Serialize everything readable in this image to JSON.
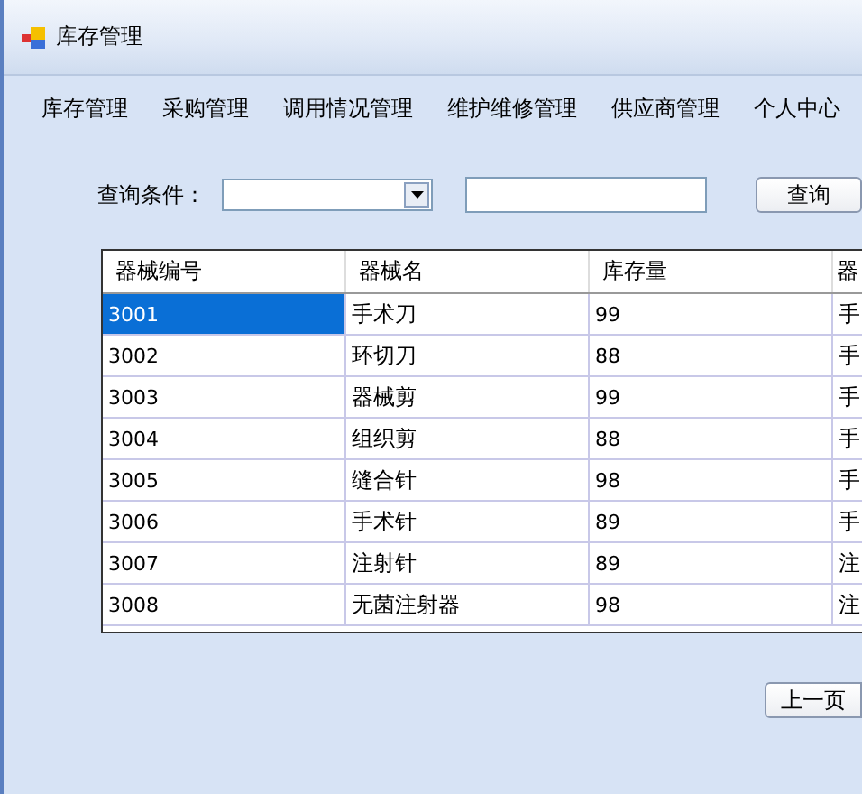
{
  "window": {
    "title": "库存管理"
  },
  "menu": [
    {
      "label": "库存管理"
    },
    {
      "label": "采购管理"
    },
    {
      "label": "调用情况管理"
    },
    {
      "label": "维护维修管理"
    },
    {
      "label": "供应商管理"
    },
    {
      "label": "个人中心"
    }
  ],
  "query": {
    "label": "查询条件：",
    "button": "查询"
  },
  "table": {
    "columns": [
      "器械编号",
      "器械名",
      "库存量",
      "器"
    ],
    "rows": [
      {
        "cells": [
          "3001",
          "手术刀",
          "99",
          "手"
        ],
        "selected": true
      },
      {
        "cells": [
          "3002",
          "环切刀",
          "88",
          "手"
        ],
        "selected": false
      },
      {
        "cells": [
          "3003",
          "器械剪",
          "99",
          "手"
        ],
        "selected": false
      },
      {
        "cells": [
          "3004",
          "组织剪",
          "88",
          "手"
        ],
        "selected": false
      },
      {
        "cells": [
          "3005",
          "缝合针",
          "98",
          "手"
        ],
        "selected": false
      },
      {
        "cells": [
          "3006",
          "手术针",
          "89",
          "手"
        ],
        "selected": false
      },
      {
        "cells": [
          "3007",
          "注射针",
          "89",
          "注"
        ],
        "selected": false
      },
      {
        "cells": [
          "3008",
          "无菌注射器",
          "98",
          "注"
        ],
        "selected": false
      }
    ]
  },
  "pager": {
    "prev": "上一页"
  }
}
